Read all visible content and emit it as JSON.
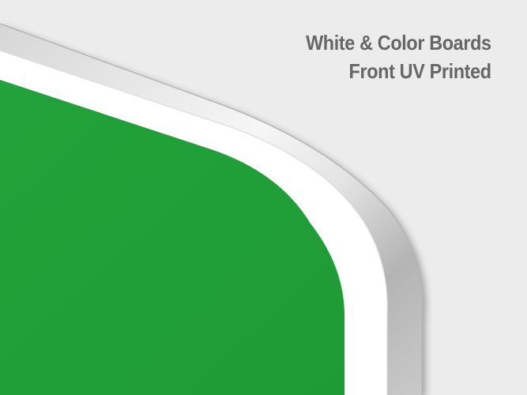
{
  "headline": {
    "line1": "White & Color Boards",
    "line2": "Front UV Printed"
  },
  "colors": {
    "background": "#ececec",
    "board_face": "#22a23a",
    "board_border": "#ffffff",
    "frame_light": "#f3f3f3",
    "frame_dark": "#a9a9a9",
    "headline_text": "#666666"
  },
  "icons": {
    "board": "rounded-corner-board-illustration"
  }
}
